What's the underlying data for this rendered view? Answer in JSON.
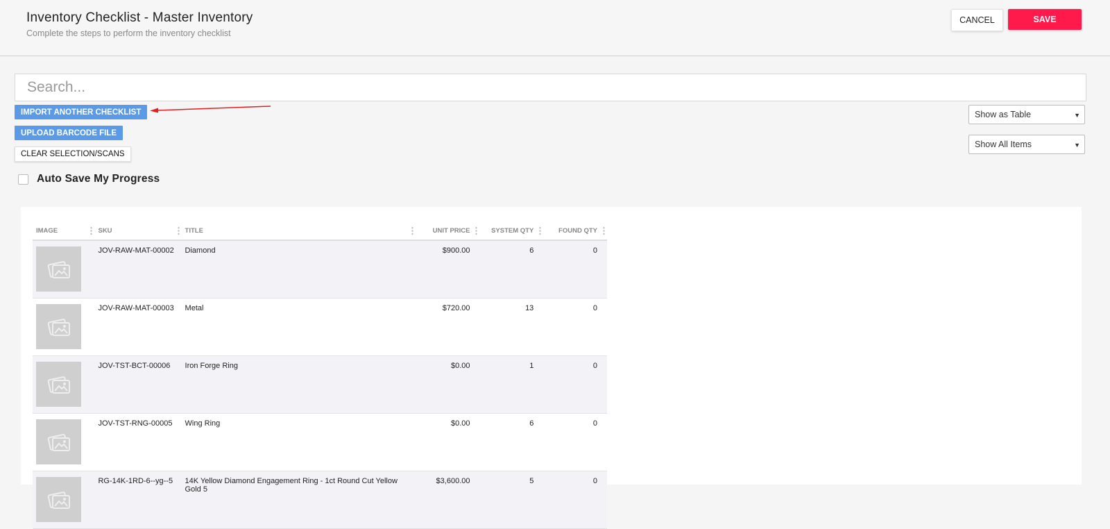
{
  "header": {
    "title": "Inventory Checklist - Master Inventory",
    "subtitle": "Complete the steps to perform the inventory checklist",
    "cancel_label": "CANCEL",
    "save_label": "SAVE",
    "save_color": "#ff1a4b"
  },
  "search": {
    "placeholder": "Search..."
  },
  "actions": {
    "import_label": "IMPORT ANOTHER CHECKLIST",
    "upload_label": "UPLOAD BARCODE FILE",
    "clear_label": "CLEAR SELECTION/SCANS",
    "button_color": "#5b9ae6"
  },
  "filters": {
    "view_mode": "Show as Table",
    "item_filter": "Show All Items"
  },
  "autosave": {
    "label": "Auto Save My Progress",
    "checked": false
  },
  "table": {
    "columns": [
      "IMAGE",
      "SKU",
      "TITLE",
      "UNIT PRICE",
      "SYSTEM QTY",
      "FOUND QTY"
    ],
    "rows": [
      {
        "image_icon": "image-placeholder-icon",
        "sku": "JOV-RAW-MAT-00002",
        "title": "Diamond",
        "unit_price": "$900.00",
        "system_qty": "6",
        "found_qty": "0"
      },
      {
        "image_icon": "image-placeholder-icon",
        "sku": "JOV-RAW-MAT-00003",
        "title": "Metal",
        "unit_price": "$720.00",
        "system_qty": "13",
        "found_qty": "0"
      },
      {
        "image_icon": "image-placeholder-icon",
        "sku": "JOV-TST-BCT-00006",
        "title": "Iron Forge Ring",
        "unit_price": "$0.00",
        "system_qty": "1",
        "found_qty": "0"
      },
      {
        "image_icon": "image-placeholder-icon",
        "sku": "JOV-TST-RNG-00005",
        "title": "Wing Ring",
        "unit_price": "$0.00",
        "system_qty": "6",
        "found_qty": "0"
      },
      {
        "image_icon": "image-placeholder-icon",
        "sku": "RG-14K-1RD-6--yg--5",
        "title": "14K Yellow Diamond Engagement Ring - 1ct Round Cut Yellow Gold 5",
        "unit_price": "$3,600.00",
        "system_qty": "5",
        "found_qty": "0"
      }
    ]
  },
  "annotation": {
    "arrow_color": "#e02020"
  }
}
